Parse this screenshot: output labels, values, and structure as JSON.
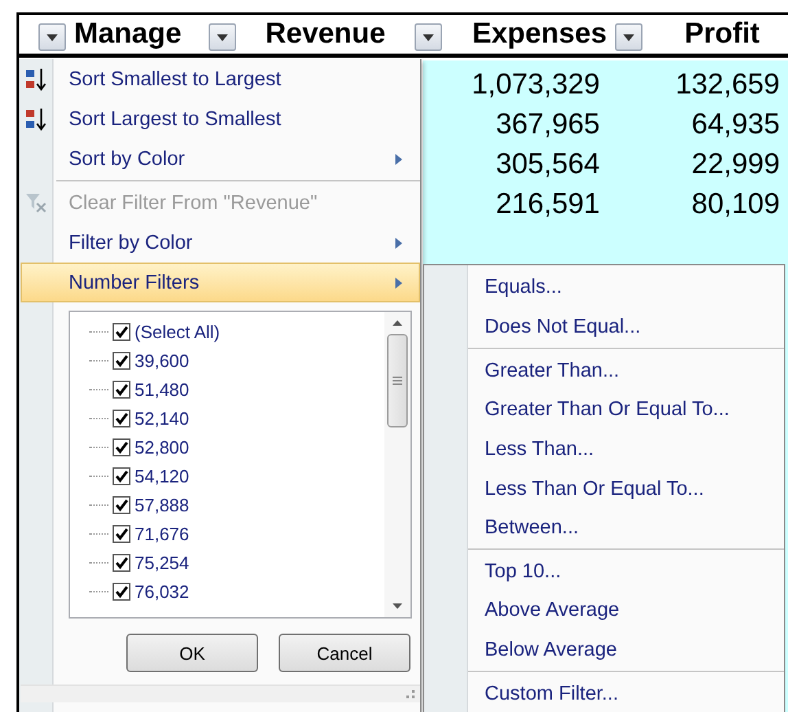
{
  "columns": [
    {
      "header": "Manage"
    },
    {
      "header": "Revenue"
    },
    {
      "header": "Expenses"
    },
    {
      "header": "Profit"
    }
  ],
  "rows": [
    {
      "expenses": "1,073,329",
      "profit": "132,659"
    },
    {
      "expenses": "367,965",
      "profit": "64,935"
    },
    {
      "expenses": "305,564",
      "profit": "22,999"
    },
    {
      "expenses": "216,591",
      "profit": "80,109"
    }
  ],
  "filter_menu": {
    "items": [
      {
        "kind": "sort_ascending",
        "label": "Sort Smallest to Largest",
        "disabled": false,
        "submenu": false,
        "selected": false
      },
      {
        "kind": "sort_descending",
        "label": "Sort Largest to Smallest",
        "disabled": false,
        "submenu": false,
        "selected": false
      },
      {
        "kind": "item",
        "label": "Sort by Color",
        "disabled": false,
        "submenu": true,
        "selected": false
      },
      {
        "kind": "separator"
      },
      {
        "kind": "clear_filter",
        "label": "Clear Filter From \"Revenue\"",
        "disabled": true,
        "submenu": false,
        "selected": false
      },
      {
        "kind": "item",
        "label": "Filter by Color",
        "disabled": false,
        "submenu": true,
        "selected": false
      },
      {
        "kind": "item",
        "label": "Number Filters",
        "disabled": false,
        "submenu": true,
        "selected": true
      }
    ],
    "values": [
      {
        "label": "(Select All)",
        "checked": true
      },
      {
        "label": "39,600",
        "checked": true
      },
      {
        "label": "51,480",
        "checked": true
      },
      {
        "label": "52,140",
        "checked": true
      },
      {
        "label": "52,800",
        "checked": true
      },
      {
        "label": "54,120",
        "checked": true
      },
      {
        "label": "57,888",
        "checked": true
      },
      {
        "label": "71,676",
        "checked": true
      },
      {
        "label": "75,254",
        "checked": true
      },
      {
        "label": "76,032",
        "checked": true
      }
    ],
    "buttons": [
      "OK",
      "Cancel"
    ]
  },
  "number_filters_submenu": {
    "items": [
      {
        "kind": "item",
        "label": "Equals..."
      },
      {
        "kind": "item",
        "label": "Does Not Equal..."
      },
      {
        "kind": "separator"
      },
      {
        "kind": "item",
        "label": "Greater Than..."
      },
      {
        "kind": "item",
        "label": "Greater Than Or Equal To..."
      },
      {
        "kind": "item",
        "label": "Less Than..."
      },
      {
        "kind": "item",
        "label": "Less Than Or Equal To..."
      },
      {
        "kind": "item",
        "label": "Between..."
      },
      {
        "kind": "separator"
      },
      {
        "kind": "item",
        "label": "Top 10..."
      },
      {
        "kind": "item",
        "label": "Above Average"
      },
      {
        "kind": "item",
        "label": "Below Average"
      },
      {
        "kind": "separator"
      },
      {
        "kind": "item",
        "label": "Custom Filter..."
      }
    ]
  }
}
